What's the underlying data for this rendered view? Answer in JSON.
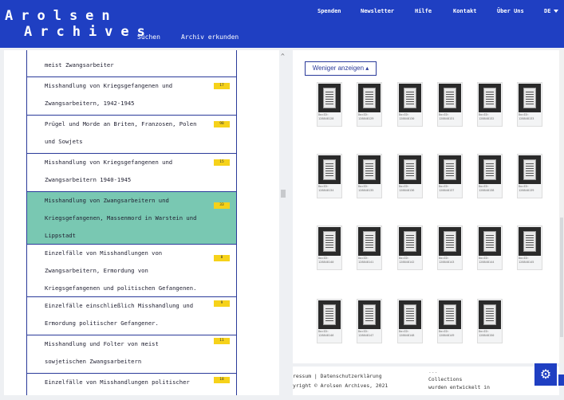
{
  "header": {
    "logo_line1": "Arolsen",
    "logo_line2": "Archives",
    "nav_sub": [
      "Suchen",
      "Archiv erkunden"
    ],
    "nav_top": [
      "Spenden",
      "Newsletter",
      "Hilfe",
      "Kontakt",
      "Über Uns",
      "DE"
    ]
  },
  "list": {
    "items": [
      {
        "text": "meist Zwangsarbeiter",
        "badge": ""
      },
      {
        "text": "Misshandlung von Kriegsgefangenen und\nZwangsarbeitern, 1942-1945",
        "badge": "17"
      },
      {
        "text": "Prügel und Morde an Briten, Franzosen, Polen\nund Sowjets",
        "badge": "98"
      },
      {
        "text": "Misshandlung von Kriegsgefangenen und\nZwangsarbeitern 1940-1945",
        "badge": "15"
      },
      {
        "text": "Misshandlung von Zwangsarbeitern und\nKriegsgefangenen, Massenmord in Warstein und\nLippstadt",
        "badge": "33"
      },
      {
        "text": "Einzelfälle von Misshandlungen von\nZwangsarbeitern, Ermordung von\nKriegsgefangenen und politischen Gefangenen.",
        "badge": "8"
      },
      {
        "text": "Einzelfälle einschließlich Misshandlung und\nErmordung politischer Gefangener.",
        "badge": "9"
      },
      {
        "text": "Misshandlung und Folter von meist\nsowjetischen Zwangsarbeitern",
        "badge": "11"
      },
      {
        "text": "Einzelfälle von Misshandlungen politischer",
        "badge": "18"
      }
    ]
  },
  "docs": {
    "toggle_label": "Weniger anzeigen ▴",
    "items": [
      {
        "label": "DocID:",
        "id": "128848128"
      },
      {
        "label": "DocID:",
        "id": "128848129"
      },
      {
        "label": "DocID:",
        "id": "128848130"
      },
      {
        "label": "DocID:",
        "id": "128848131"
      },
      {
        "label": "DocID:",
        "id": "128848132"
      },
      {
        "label": "DocID:",
        "id": "128848133"
      },
      {
        "label": "DocID:",
        "id": "128848134"
      },
      {
        "label": "DocID:",
        "id": "128848135"
      },
      {
        "label": "DocID:",
        "id": "128848136"
      },
      {
        "label": "DocID:",
        "id": "128848137"
      },
      {
        "label": "DocID:",
        "id": "128848138"
      },
      {
        "label": "DocID:",
        "id": "128848139"
      },
      {
        "label": "DocID:",
        "id": "128848140"
      },
      {
        "label": "DocID:",
        "id": "128848141"
      },
      {
        "label": "DocID:",
        "id": "128848142"
      },
      {
        "label": "DocID:",
        "id": "128848143"
      },
      {
        "label": "DocID:",
        "id": "128848144"
      },
      {
        "label": "DocID:",
        "id": "128848145"
      },
      {
        "label": "DocID:",
        "id": "128848146"
      },
      {
        "label": "DocID:",
        "id": "128848147"
      },
      {
        "label": "DocID:",
        "id": "128848148"
      },
      {
        "label": "DocID:",
        "id": "128848149"
      },
      {
        "label": "DocID:",
        "id": "128848150"
      }
    ]
  },
  "footer": {
    "links": "ressum | Datenschutzerklärung",
    "copyright": "yright © Arolsen Archives, 2021",
    "col2_line1": "Collections",
    "col2_line2": "wurden entwickelt in",
    "col2_top": "..."
  },
  "settings_icon": "gear-icon"
}
